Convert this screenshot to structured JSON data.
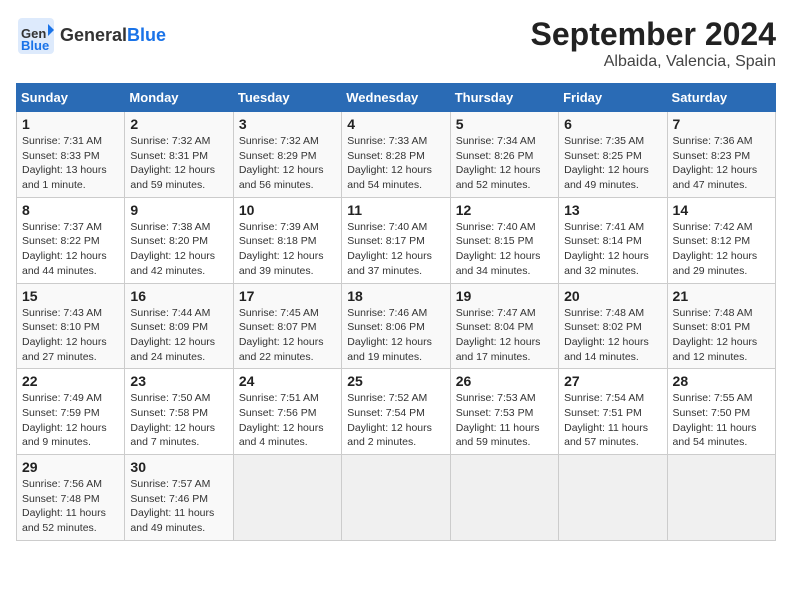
{
  "header": {
    "logo_general": "General",
    "logo_blue": "Blue",
    "month": "September 2024",
    "location": "Albaida, Valencia, Spain"
  },
  "days_of_week": [
    "Sunday",
    "Monday",
    "Tuesday",
    "Wednesday",
    "Thursday",
    "Friday",
    "Saturday"
  ],
  "weeks": [
    [
      {
        "day": "1",
        "info": "Sunrise: 7:31 AM\nSunset: 8:33 PM\nDaylight: 13 hours\nand 1 minute."
      },
      {
        "day": "2",
        "info": "Sunrise: 7:32 AM\nSunset: 8:31 PM\nDaylight: 12 hours\nand 59 minutes."
      },
      {
        "day": "3",
        "info": "Sunrise: 7:32 AM\nSunset: 8:29 PM\nDaylight: 12 hours\nand 56 minutes."
      },
      {
        "day": "4",
        "info": "Sunrise: 7:33 AM\nSunset: 8:28 PM\nDaylight: 12 hours\nand 54 minutes."
      },
      {
        "day": "5",
        "info": "Sunrise: 7:34 AM\nSunset: 8:26 PM\nDaylight: 12 hours\nand 52 minutes."
      },
      {
        "day": "6",
        "info": "Sunrise: 7:35 AM\nSunset: 8:25 PM\nDaylight: 12 hours\nand 49 minutes."
      },
      {
        "day": "7",
        "info": "Sunrise: 7:36 AM\nSunset: 8:23 PM\nDaylight: 12 hours\nand 47 minutes."
      }
    ],
    [
      {
        "day": "8",
        "info": "Sunrise: 7:37 AM\nSunset: 8:22 PM\nDaylight: 12 hours\nand 44 minutes."
      },
      {
        "day": "9",
        "info": "Sunrise: 7:38 AM\nSunset: 8:20 PM\nDaylight: 12 hours\nand 42 minutes."
      },
      {
        "day": "10",
        "info": "Sunrise: 7:39 AM\nSunset: 8:18 PM\nDaylight: 12 hours\nand 39 minutes."
      },
      {
        "day": "11",
        "info": "Sunrise: 7:40 AM\nSunset: 8:17 PM\nDaylight: 12 hours\nand 37 minutes."
      },
      {
        "day": "12",
        "info": "Sunrise: 7:40 AM\nSunset: 8:15 PM\nDaylight: 12 hours\nand 34 minutes."
      },
      {
        "day": "13",
        "info": "Sunrise: 7:41 AM\nSunset: 8:14 PM\nDaylight: 12 hours\nand 32 minutes."
      },
      {
        "day": "14",
        "info": "Sunrise: 7:42 AM\nSunset: 8:12 PM\nDaylight: 12 hours\nand 29 minutes."
      }
    ],
    [
      {
        "day": "15",
        "info": "Sunrise: 7:43 AM\nSunset: 8:10 PM\nDaylight: 12 hours\nand 27 minutes."
      },
      {
        "day": "16",
        "info": "Sunrise: 7:44 AM\nSunset: 8:09 PM\nDaylight: 12 hours\nand 24 minutes."
      },
      {
        "day": "17",
        "info": "Sunrise: 7:45 AM\nSunset: 8:07 PM\nDaylight: 12 hours\nand 22 minutes."
      },
      {
        "day": "18",
        "info": "Sunrise: 7:46 AM\nSunset: 8:06 PM\nDaylight: 12 hours\nand 19 minutes."
      },
      {
        "day": "19",
        "info": "Sunrise: 7:47 AM\nSunset: 8:04 PM\nDaylight: 12 hours\nand 17 minutes."
      },
      {
        "day": "20",
        "info": "Sunrise: 7:48 AM\nSunset: 8:02 PM\nDaylight: 12 hours\nand 14 minutes."
      },
      {
        "day": "21",
        "info": "Sunrise: 7:48 AM\nSunset: 8:01 PM\nDaylight: 12 hours\nand 12 minutes."
      }
    ],
    [
      {
        "day": "22",
        "info": "Sunrise: 7:49 AM\nSunset: 7:59 PM\nDaylight: 12 hours\nand 9 minutes."
      },
      {
        "day": "23",
        "info": "Sunrise: 7:50 AM\nSunset: 7:58 PM\nDaylight: 12 hours\nand 7 minutes."
      },
      {
        "day": "24",
        "info": "Sunrise: 7:51 AM\nSunset: 7:56 PM\nDaylight: 12 hours\nand 4 minutes."
      },
      {
        "day": "25",
        "info": "Sunrise: 7:52 AM\nSunset: 7:54 PM\nDaylight: 12 hours\nand 2 minutes."
      },
      {
        "day": "26",
        "info": "Sunrise: 7:53 AM\nSunset: 7:53 PM\nDaylight: 11 hours\nand 59 minutes."
      },
      {
        "day": "27",
        "info": "Sunrise: 7:54 AM\nSunset: 7:51 PM\nDaylight: 11 hours\nand 57 minutes."
      },
      {
        "day": "28",
        "info": "Sunrise: 7:55 AM\nSunset: 7:50 PM\nDaylight: 11 hours\nand 54 minutes."
      }
    ],
    [
      {
        "day": "29",
        "info": "Sunrise: 7:56 AM\nSunset: 7:48 PM\nDaylight: 11 hours\nand 52 minutes."
      },
      {
        "day": "30",
        "info": "Sunrise: 7:57 AM\nSunset: 7:46 PM\nDaylight: 11 hours\nand 49 minutes."
      },
      {
        "day": "",
        "info": ""
      },
      {
        "day": "",
        "info": ""
      },
      {
        "day": "",
        "info": ""
      },
      {
        "day": "",
        "info": ""
      },
      {
        "day": "",
        "info": ""
      }
    ]
  ]
}
